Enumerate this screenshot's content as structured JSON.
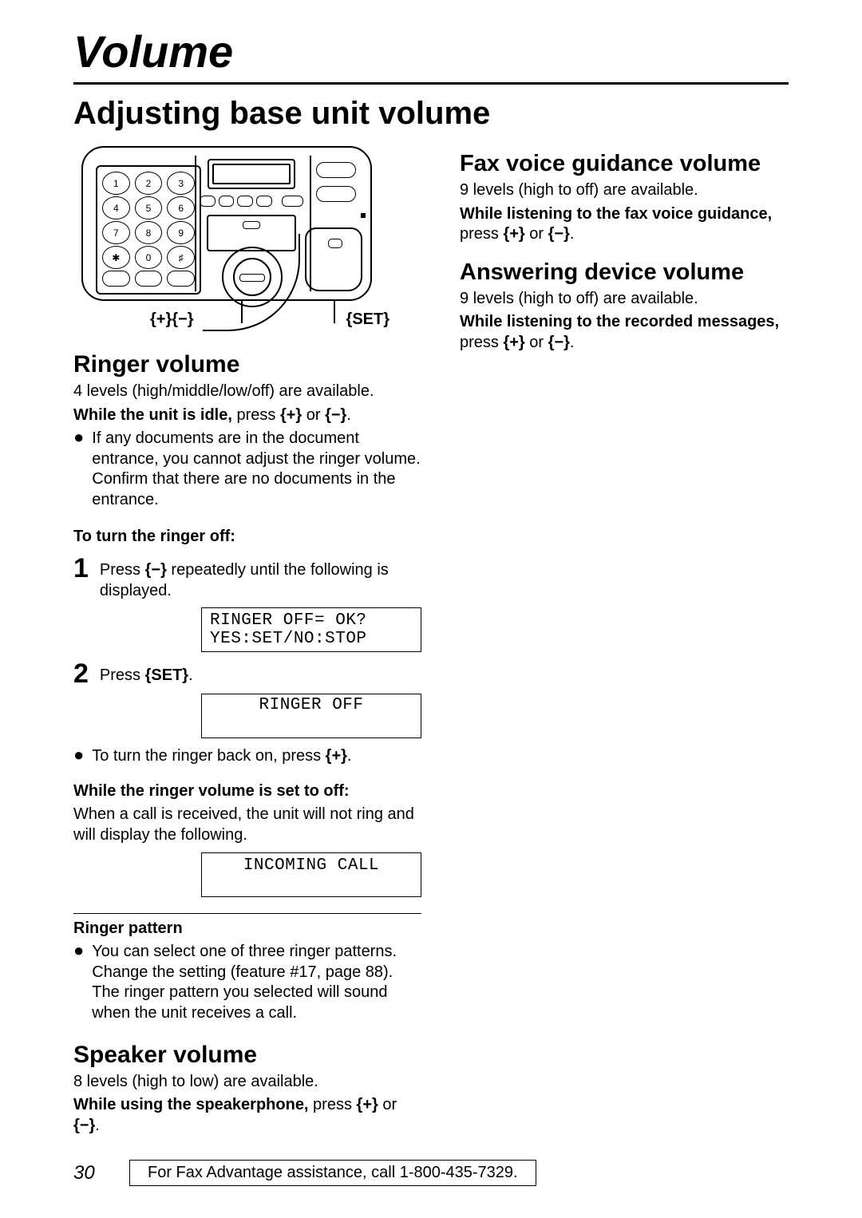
{
  "chapter": "Volume",
  "heading": "Adjusting base unit volume",
  "device_labels": {
    "plus_minus": "{+}{−}",
    "set": "{SET}"
  },
  "key_plus": "{+}",
  "key_minus": "{−}",
  "key_set": "{SET}",
  "left": {
    "ringer": {
      "title": "Ringer volume",
      "line1": "4 levels (high/middle/low/off) are available.",
      "line2a": "While the unit is idle,",
      "line2b": " press ",
      "bullet1": "If any documents are in the document entrance, you cannot adjust the ringer volume. Confirm that there are no documents in the entrance.",
      "turn_off_head": "To turn the ringer off:",
      "step1_text": "Press ",
      "step1_tail": " repeatedly until the following is displayed.",
      "display1": "RINGER OFF= OK?\nYES:SET/NO:STOP",
      "step2_text": "Press ",
      "display2": "RINGER OFF",
      "back_on_pre": "To turn the ringer back on, press ",
      "while_off_head": "While the ringer volume is set to off:",
      "while_off_body": "When a call is received, the unit will not ring and will display the following.",
      "display3": "INCOMING CALL",
      "pattern_head": "Ringer pattern",
      "pattern_bullet": "You can select one of three ringer patterns. Change the setting (feature #17, page 88). The ringer pattern you selected will sound when the unit receives a call."
    },
    "speaker": {
      "title": "Speaker volume",
      "line1": "8 levels (high to low) are available.",
      "line2a": "While using the speakerphone,",
      "line2b": " press "
    }
  },
  "right": {
    "fax": {
      "title": "Fax voice guidance volume",
      "line1": "9 levels (high to off) are available.",
      "line2a": "While listening to the fax voice guidance,",
      "line2b": "press "
    },
    "ans": {
      "title": "Answering device volume",
      "line1": "9 levels (high to off) are available.",
      "line2a": "While listening to the recorded messages,",
      "line2b": "press "
    }
  },
  "footer": {
    "page_no": "30",
    "assist": "For Fax Advantage assistance, call 1-800-435-7329."
  },
  "keypad": [
    "1",
    "2",
    "3",
    "4",
    "5",
    "6",
    "7",
    "8",
    "9",
    "✱",
    "0",
    "♯"
  ]
}
